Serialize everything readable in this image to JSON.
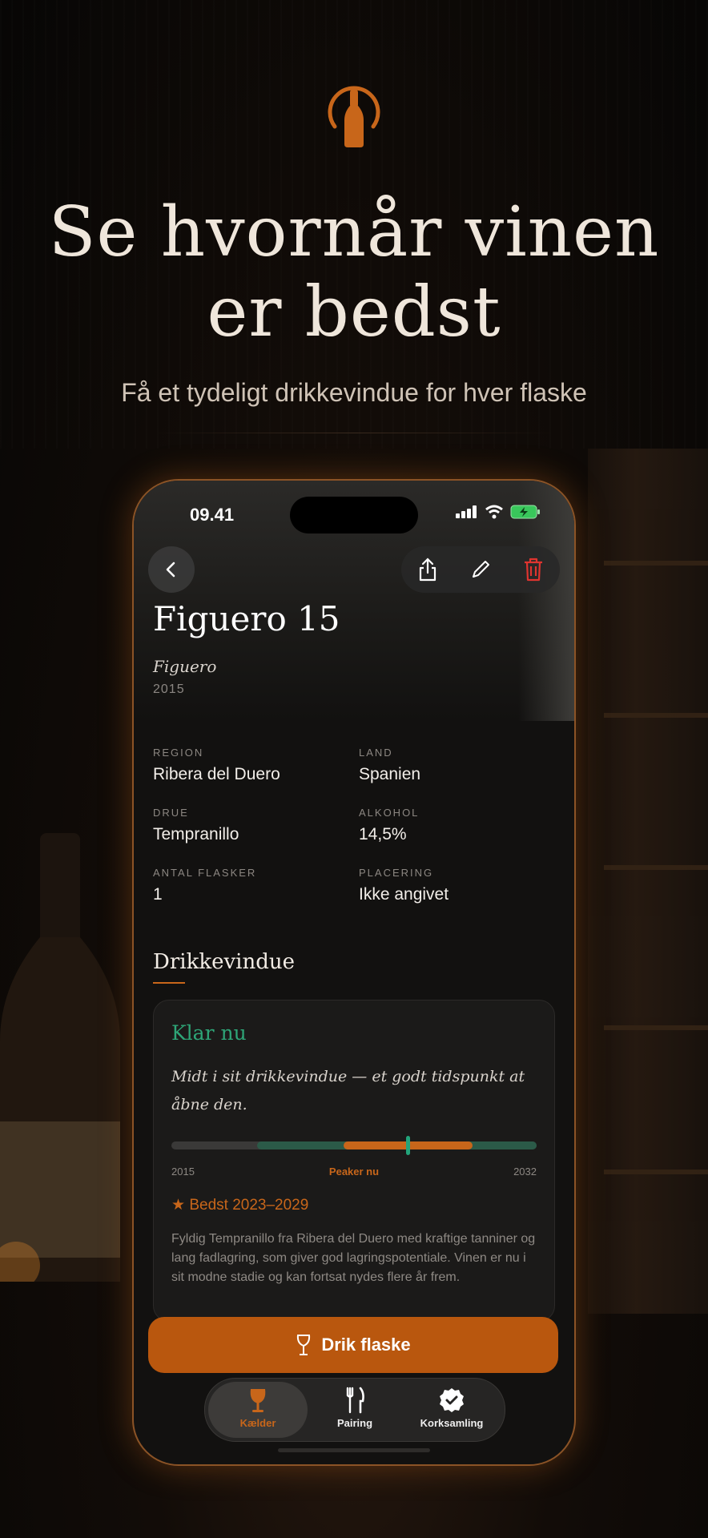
{
  "colors": {
    "accent": "#c8661a",
    "ready": "#2ea577",
    "danger": "#e0342f",
    "button": "#b9570e"
  },
  "header": {
    "logo_icon": "wine-bottle-icon",
    "title_line1": "Se hvornår vinen",
    "title_line2": "er bedst",
    "subtitle": "Få et tydeligt drikkevindue for hver flaske"
  },
  "status_bar": {
    "time": "09.41"
  },
  "wine": {
    "name": "Figuero 15",
    "producer": "Figuero",
    "vintage": "2015"
  },
  "facts": [
    {
      "label": "REGION",
      "value": "Ribera del Duero"
    },
    {
      "label": "LAND",
      "value": "Spanien"
    },
    {
      "label": "DRUE",
      "value": "Tempranillo"
    },
    {
      "label": "ALKOHOL",
      "value": "14,5%"
    },
    {
      "label": "ANTAL FLASKER",
      "value": "1"
    },
    {
      "label": "PLACERING",
      "value": "Ikke angivet"
    }
  ],
  "window": {
    "section_title": "Drikkevindue",
    "status": "Klar nu",
    "description": "Midt i sit drikkevindue — et godt tidspunkt at åbne den.",
    "start_label": "2015",
    "peak_label": "Peaker nu",
    "end_label": "2032",
    "timeline": {
      "start": 2015,
      "end": 2032,
      "drinkable_from": 2019,
      "drinkable_to": 2032,
      "peak_from": 2023,
      "peak_to": 2029,
      "now": 2026
    },
    "best": "Bedst 2023–2029",
    "note": "Fyldig Tempranillo fra Ribera del Duero med kraftige tanniner og lang fadlagring, som giver god lagringspotentiale. Vinen er nu i sit modne stadie og kan fortsat nydes flere år frem."
  },
  "actions": {
    "drink": "Drik flaske"
  },
  "tabs": [
    {
      "label": "Kælder",
      "icon": "wine-glass-icon"
    },
    {
      "label": "Pairing",
      "icon": "fork-knife-icon"
    },
    {
      "label": "Korksamling",
      "icon": "badge-check-icon"
    }
  ]
}
